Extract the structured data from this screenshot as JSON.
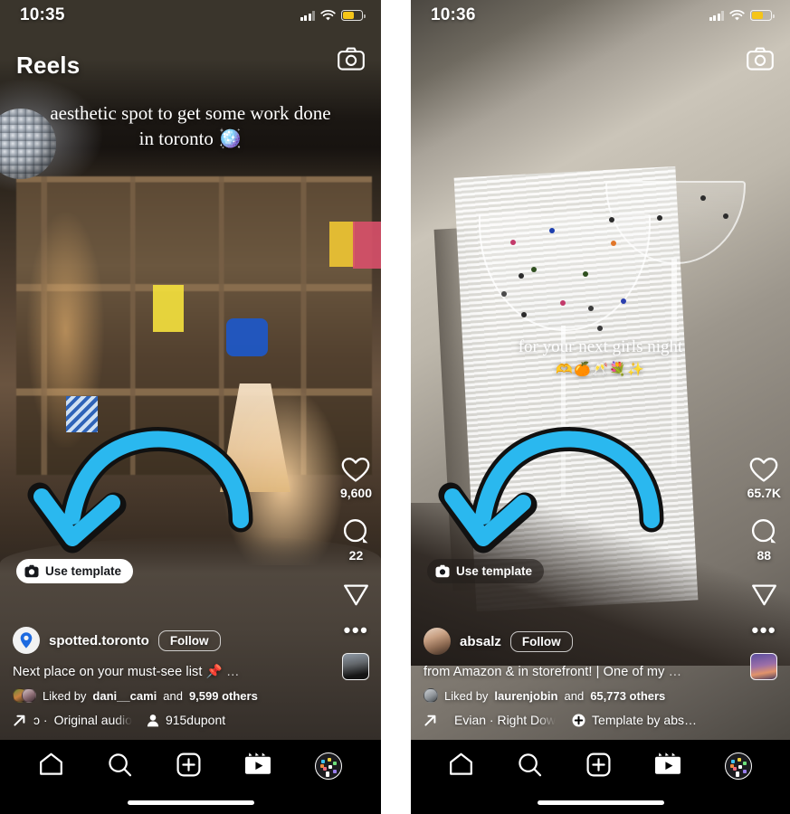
{
  "app": {
    "name": "Instagram Reels"
  },
  "left": {
    "status": {
      "time": "10:35",
      "signal_icon": "cellular-bars-icon",
      "wifi_icon": "wifi-icon",
      "battery_icon": "battery-icon"
    },
    "header": {
      "title": "Reels",
      "camera_icon": "camera-icon"
    },
    "burned_caption": {
      "line1": "aesthetic spot to get some work done",
      "line2": "in toronto 🪩"
    },
    "actions": {
      "like_icon": "heart-icon",
      "like_count": "9,600",
      "comment_icon": "comment-icon",
      "comment_count": "22",
      "share_icon": "paper-plane-icon",
      "more_icon": "ellipsis-icon",
      "audio_thumb": "audio-cover-thumbnail"
    },
    "template_button": {
      "label": "Use template",
      "icon": "camera-template-icon"
    },
    "account": {
      "username": "spotted.toronto",
      "avatar_icon": "location-pin-avatar",
      "follow_label": "Follow"
    },
    "caption": {
      "text": "Next place on your must-see list 📌",
      "more": "…"
    },
    "likes": {
      "prefix": "Liked by",
      "name": "dani__cami",
      "middle": "and",
      "count": "9,599 others"
    },
    "audio": {
      "share_icon": "share-arrow-icon",
      "scroll_fragment": "ɔ ·",
      "title": "Original audio",
      "tag_icon": "person-icon",
      "tag_label": "915dupont"
    }
  },
  "right": {
    "status": {
      "time": "10:36",
      "signal_icon": "cellular-bars-icon",
      "wifi_icon": "wifi-icon",
      "battery_icon": "battery-icon"
    },
    "header": {
      "title": "",
      "camera_icon": "camera-icon"
    },
    "burned_caption": {
      "line1": "for your next girls night",
      "line2": "🫶🍊🥂💐✨"
    },
    "actions": {
      "like_icon": "heart-icon",
      "like_count": "65.7K",
      "comment_icon": "comment-icon",
      "comment_count": "88",
      "share_icon": "paper-plane-icon",
      "more_icon": "ellipsis-icon",
      "audio_thumb": "audio-cover-thumbnail"
    },
    "template_button": {
      "label": "Use template",
      "icon": "camera-template-icon"
    },
    "account": {
      "username": "absalz",
      "avatar_icon": "profile-photo-avatar",
      "follow_label": "Follow"
    },
    "caption": {
      "text": "from Amazon & in storefront! | One of my",
      "more": "…"
    },
    "likes": {
      "prefix": "Liked by",
      "name": "laurenjobin",
      "middle": "and",
      "count": "65,773 others"
    },
    "audio": {
      "share_icon": "share-arrow-icon",
      "scroll_fragment": "",
      "title": "Evian · Right Dow",
      "tag_icon": "plus-circle-icon",
      "tag_label": "Template by abs…"
    }
  },
  "tabbar": {
    "items": [
      {
        "name": "home",
        "icon": "home-icon",
        "label": "Home"
      },
      {
        "name": "search",
        "icon": "search-icon",
        "label": "Search"
      },
      {
        "name": "create",
        "icon": "plus-square-icon",
        "label": "Create"
      },
      {
        "name": "reels",
        "icon": "reels-clapper-icon",
        "label": "Reels"
      },
      {
        "name": "profile",
        "icon": "profile-avatar-icon",
        "label": "Profile"
      }
    ]
  },
  "annotation": {
    "arrow_icon": "curved-down-left-arrow",
    "color": "#2ab8ef",
    "outline": "#111111"
  },
  "colors": {
    "accent_cyan": "#2ab8ef",
    "battery_yellow": "#f5c518",
    "tabbar_black": "#000000",
    "text_white": "#ffffff",
    "pill_light": "#ffffff",
    "pill_dark": "rgba(35,30,28,.62)"
  }
}
